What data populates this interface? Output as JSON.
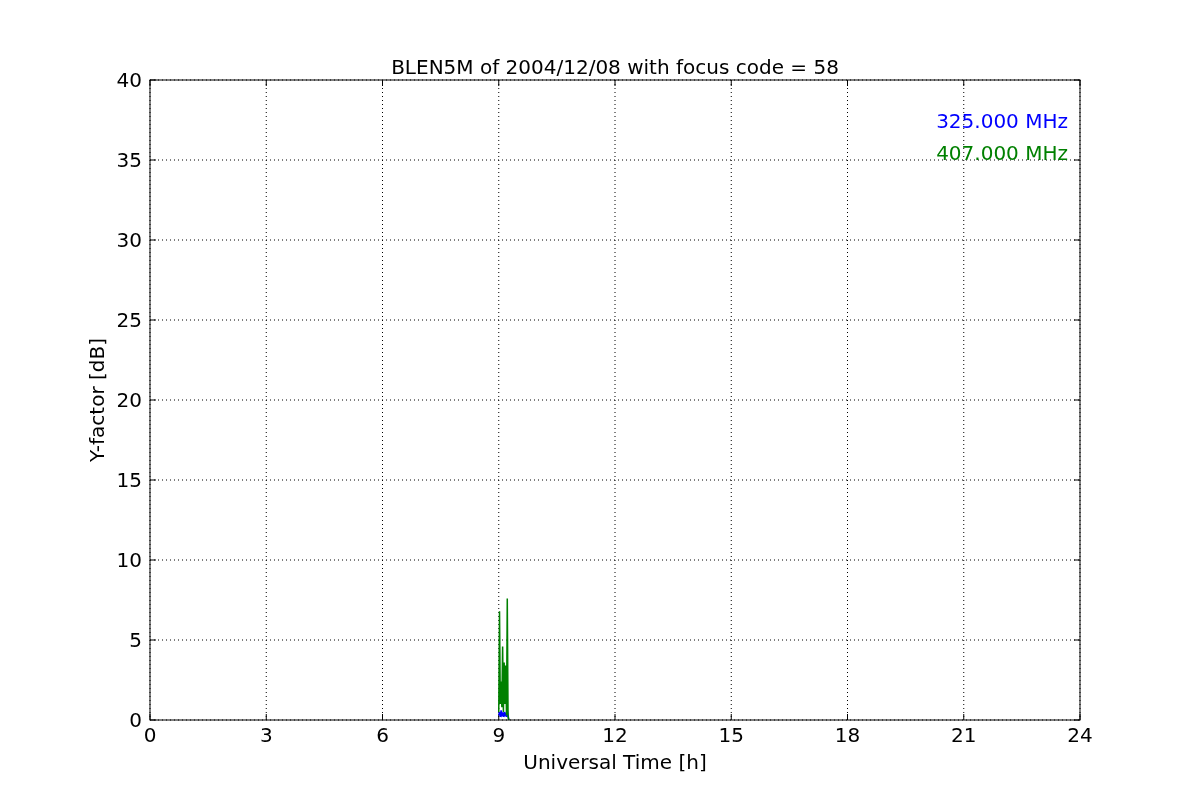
{
  "chart_data": {
    "type": "line",
    "title": "BLEN5M of 2004/12/08 with focus code = 58",
    "xlabel": "Universal Time [h]",
    "ylabel": "Y-factor [dB]",
    "x": [
      9.0,
      9.02,
      9.04,
      9.06,
      9.08,
      9.1,
      9.12,
      9.14,
      9.16,
      9.18,
      9.2,
      9.22,
      9.24,
      9.26
    ],
    "series": [
      {
        "name": "325.000 MHz",
        "color": "#0000ff",
        "values": [
          0.3,
          0.5,
          0.2,
          0.6,
          0.3,
          0.4,
          0.2,
          0.5,
          0.3,
          0.4,
          0.2,
          0.6,
          0.3,
          0.0
        ]
      },
      {
        "name": "407.000 MHz",
        "color": "#008000",
        "values": [
          0.5,
          6.8,
          1.0,
          2.4,
          0.8,
          4.6,
          0.5,
          3.6,
          1.0,
          3.4,
          0.3,
          7.6,
          0.2,
          0.0
        ]
      }
    ],
    "xlim": [
      0,
      24
    ],
    "ylim": [
      0,
      40
    ],
    "xticks": [
      0,
      3,
      6,
      9,
      12,
      15,
      18,
      21,
      24
    ],
    "yticks": [
      0,
      5,
      10,
      15,
      20,
      25,
      30,
      35,
      40
    ],
    "grid": true
  }
}
